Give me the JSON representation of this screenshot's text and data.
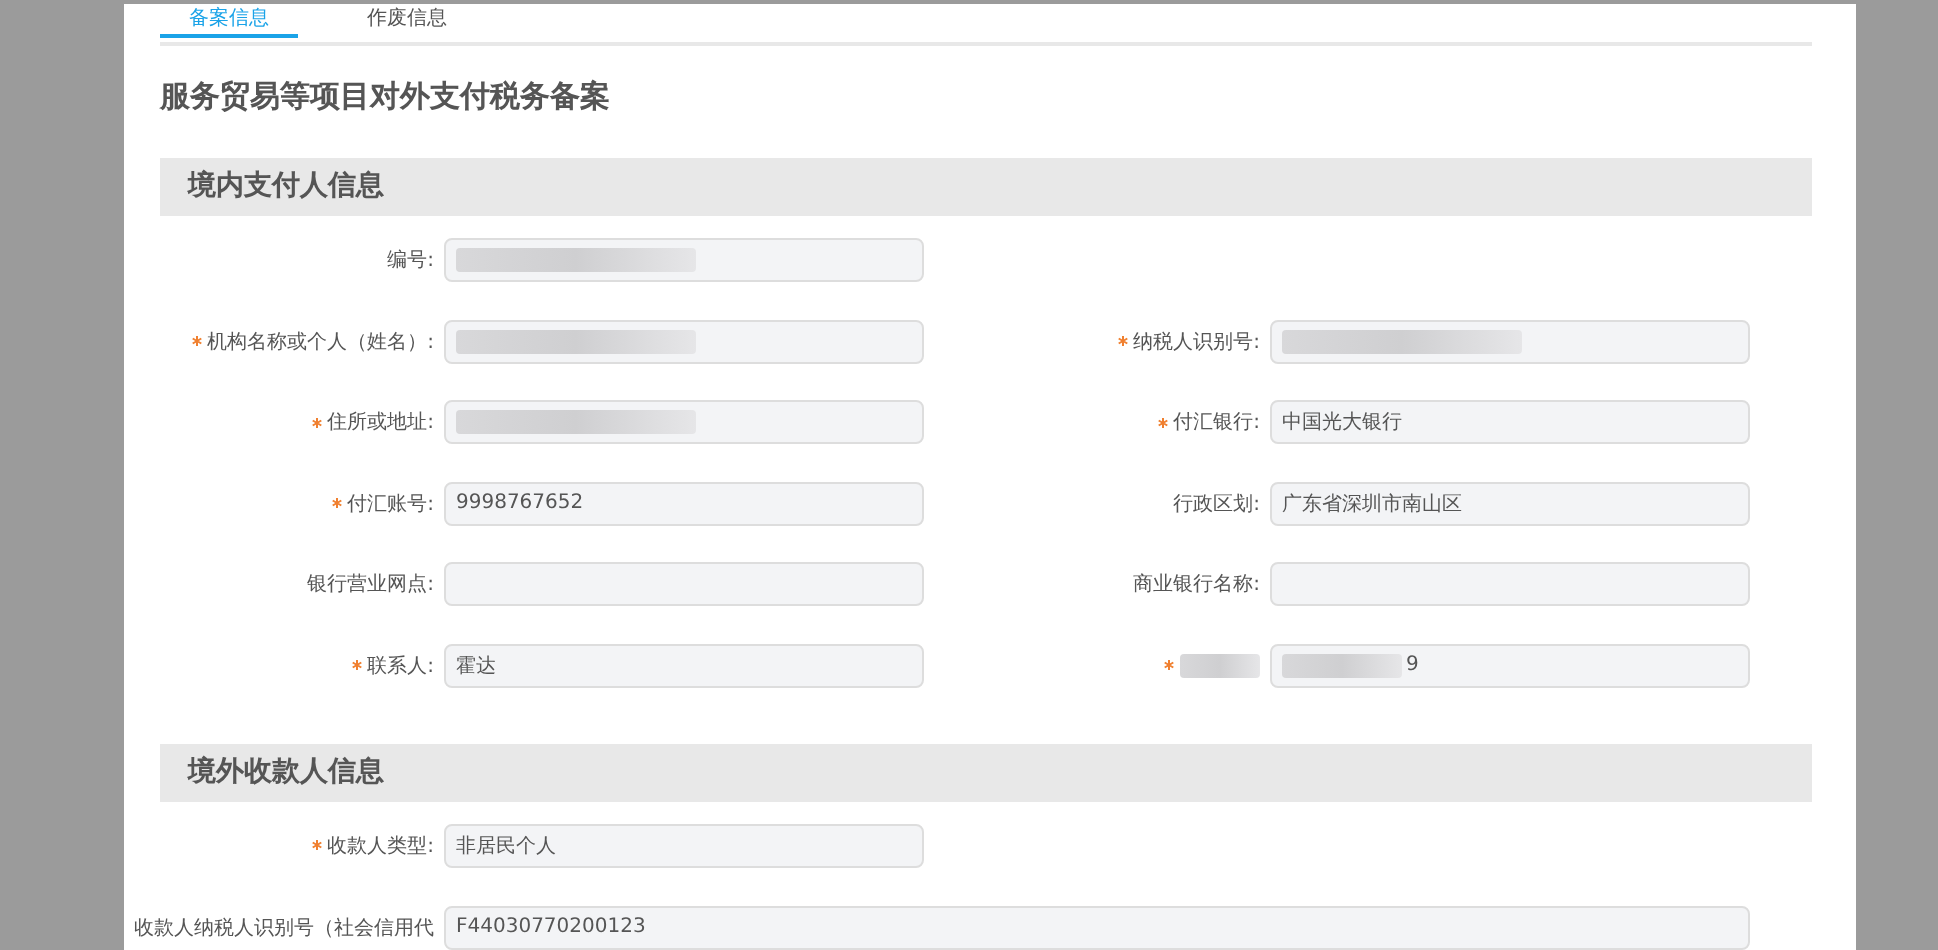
{
  "tabs": [
    {
      "label": "备案信息",
      "selected": true
    },
    {
      "label": "作废信息",
      "selected": false
    }
  ],
  "title": "服务贸易等项目对外支付税务备案",
  "sections": [
    {
      "heading": "境内支付人信息",
      "rows": [
        {
          "fields": [
            {
              "label": "编号:",
              "required": false,
              "redacted": true
            }
          ]
        },
        {
          "fields": [
            {
              "label": "机构名称或个人（姓名）:",
              "required": true,
              "redacted": true
            },
            {
              "label": "纳税人识别号:",
              "required": true,
              "redacted": true
            }
          ]
        },
        {
          "fields": [
            {
              "label": "住所或地址:",
              "required": true,
              "redacted": true
            },
            {
              "label": "付汇银行:",
              "required": true,
              "value": "中国光大银行",
              "redacted": false
            }
          ]
        },
        {
          "fields": [
            {
              "label": "付汇账号:",
              "required": true,
              "value": "9998767652",
              "redacted": false
            },
            {
              "label": "行政区划:",
              "required": false,
              "value": "广东省深圳市南山区",
              "redacted": false
            }
          ]
        },
        {
          "fields": [
            {
              "label": "银行营业网点:",
              "required": false,
              "redacted": false
            },
            {
              "label": "商业银行名称:",
              "required": false,
              "redacted": false
            }
          ]
        },
        {
          "fields": [
            {
              "label": "联系人:",
              "required": true,
              "value": "霍达",
              "redacted": false
            },
            {
              "required": true,
              "value": "9",
              "redacted": true
            }
          ]
        }
      ]
    },
    {
      "heading": "境外收款人信息",
      "rows": [
        {
          "fields": [
            {
              "label": "收款人类型:",
              "required": true,
              "value": "非居民个人",
              "redacted": false
            }
          ]
        },
        {
          "fields": [
            {
              "label": "收款人纳税人识别号（社会信用代",
              "required": false,
              "value": "F44030770200123",
              "redacted": false,
              "wide": true
            }
          ]
        }
      ]
    }
  ]
}
